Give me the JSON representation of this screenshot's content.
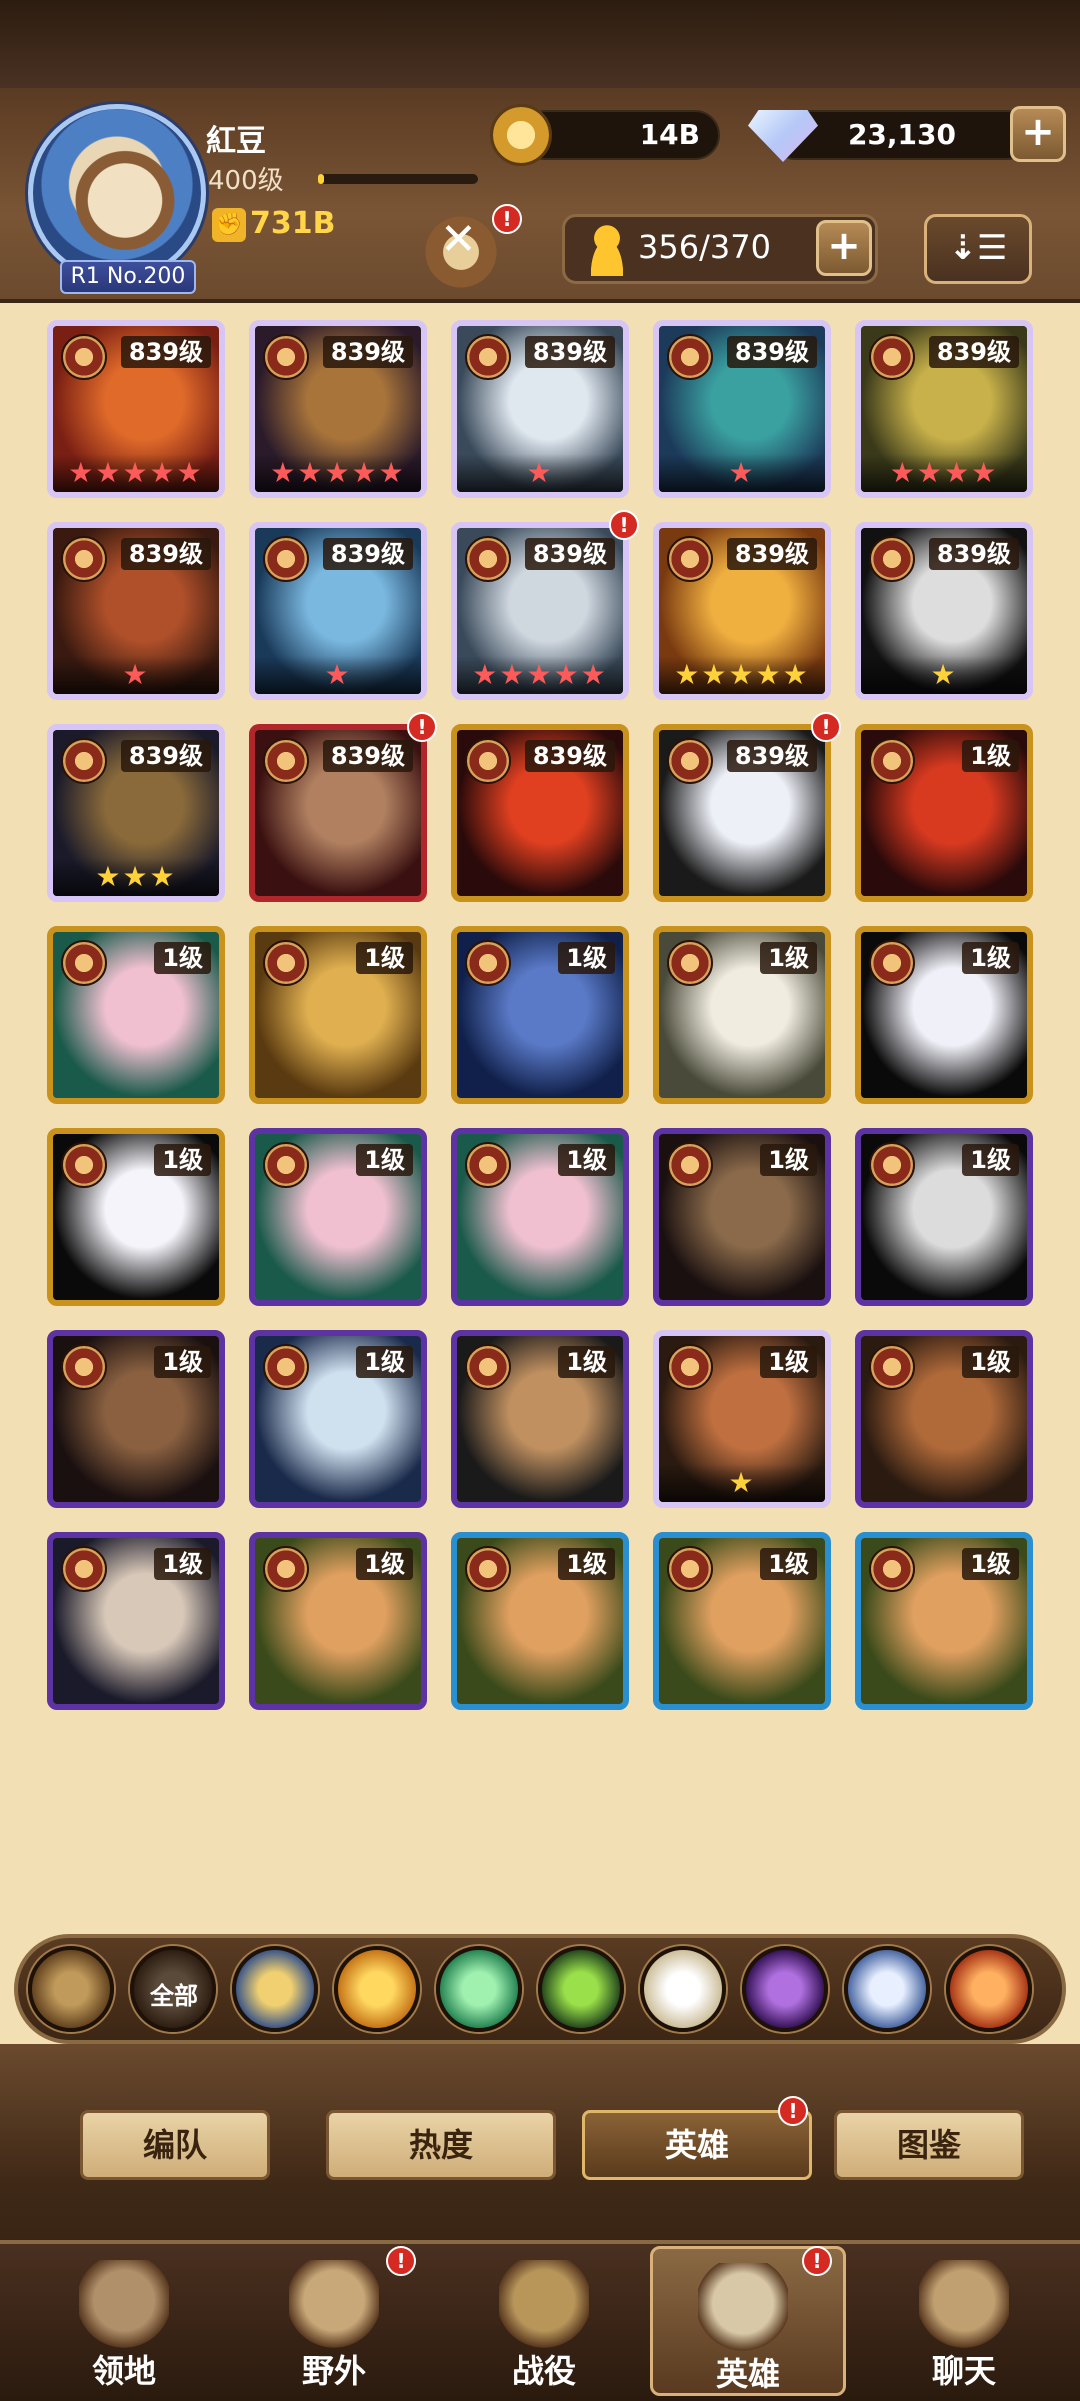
{
  "header": {
    "player_name": "紅豆",
    "player_level": "400级",
    "exp_fraction": 0.04,
    "rank_tag": "R1 No.200",
    "power": "731B",
    "gold": "14B",
    "diamonds": "23,130",
    "hero_slots": "356/370",
    "summon_alert": "!"
  },
  "heroes": [
    {
      "level": "839级",
      "stars": "★★★★★",
      "star_color": "red",
      "tier": "ascended",
      "art": [
        "#7a1f14",
        "#e06a2a"
      ],
      "alert": false
    },
    {
      "level": "839级",
      "stars": "★★★★★",
      "star_color": "red",
      "tier": "ascended",
      "art": [
        "#2a1a2a",
        "#a8743a"
      ],
      "alert": false
    },
    {
      "level": "839级",
      "stars": "★",
      "star_color": "red",
      "tier": "ascended",
      "art": [
        "#3a4a5a",
        "#dfe7ef"
      ],
      "alert": false
    },
    {
      "level": "839级",
      "stars": "★",
      "star_color": "red",
      "tier": "ascended",
      "art": [
        "#1c3a5a",
        "#3aa0a0"
      ],
      "alert": false
    },
    {
      "level": "839级",
      "stars": "★★★★",
      "star_color": "red",
      "tier": "ascended",
      "art": [
        "#3a3a1a",
        "#c8b14a"
      ],
      "alert": false
    },
    {
      "level": "839级",
      "stars": "★",
      "star_color": "red",
      "tier": "ascended",
      "art": [
        "#3a1a10",
        "#b0502a"
      ],
      "alert": false
    },
    {
      "level": "839级",
      "stars": "★",
      "star_color": "red",
      "tier": "ascended",
      "art": [
        "#1a3a5a",
        "#7ab8e0"
      ],
      "alert": false
    },
    {
      "level": "839级",
      "stars": "★★★★★",
      "star_color": "red",
      "tier": "ascended",
      "art": [
        "#3a4a5a",
        "#cfd7df"
      ],
      "alert": true
    },
    {
      "level": "839级",
      "stars": "★★★★★",
      "star_color": "gold",
      "tier": "ascended",
      "art": [
        "#7a3a10",
        "#f0b040"
      ],
      "alert": false
    },
    {
      "level": "839级",
      "stars": "★",
      "star_color": "gold",
      "tier": "ascended",
      "art": [
        "#111111",
        "#dddddd"
      ],
      "alert": false
    },
    {
      "level": "839级",
      "stars": "★★★",
      "star_color": "gold",
      "tier": "ascended",
      "art": [
        "#1a1a2a",
        "#8a6a3a"
      ],
      "alert": false
    },
    {
      "level": "839级",
      "stars": "",
      "star_color": "gold",
      "tier": "red",
      "art": [
        "#3a1010",
        "#b08060"
      ],
      "alert": true
    },
    {
      "level": "839级",
      "stars": "",
      "star_color": "gold",
      "tier": "gold",
      "art": [
        "#2a0a0a",
        "#e04020"
      ],
      "alert": false
    },
    {
      "level": "839级",
      "stars": "",
      "star_color": "gold",
      "tier": "gold",
      "art": [
        "#1a1a1a",
        "#eef0f8"
      ],
      "alert": true
    },
    {
      "level": "1级",
      "stars": "",
      "star_color": "gold",
      "tier": "gold",
      "art": [
        "#2a0a0a",
        "#d83a20"
      ],
      "alert": false
    },
    {
      "level": "1级",
      "stars": "",
      "star_color": "gold",
      "tier": "gold",
      "art": [
        "#1a5a4a",
        "#f0c0d0"
      ],
      "alert": false
    },
    {
      "level": "1级",
      "stars": "",
      "star_color": "gold",
      "tier": "gold",
      "art": [
        "#5a3a10",
        "#e0b050"
      ],
      "alert": false
    },
    {
      "level": "1级",
      "stars": "",
      "star_color": "gold",
      "tier": "gold",
      "art": [
        "#10204a",
        "#5a7ac8"
      ],
      "alert": false
    },
    {
      "level": "1级",
      "stars": "",
      "star_color": "gold",
      "tier": "gold",
      "art": [
        "#4a4a3a",
        "#f0ede0"
      ],
      "alert": false
    },
    {
      "level": "1级",
      "stars": "",
      "star_color": "gold",
      "tier": "gold",
      "art": [
        "#0a0a0a",
        "#f0f0f8"
      ],
      "alert": false
    },
    {
      "level": "1级",
      "stars": "",
      "star_color": "gold",
      "tier": "gold",
      "art": [
        "#0a0a0a",
        "#f4f4fa"
      ],
      "alert": false
    },
    {
      "level": "1级",
      "stars": "",
      "star_color": "gold",
      "tier": "purple",
      "art": [
        "#1a5a4a",
        "#f0c0d0"
      ],
      "alert": false
    },
    {
      "level": "1级",
      "stars": "",
      "star_color": "gold",
      "tier": "purple",
      "art": [
        "#1a5a4a",
        "#f0c0d0"
      ],
      "alert": false
    },
    {
      "level": "1级",
      "stars": "",
      "star_color": "gold",
      "tier": "purple",
      "art": [
        "#1a1010",
        "#8a6a4a"
      ],
      "alert": false
    },
    {
      "level": "1级",
      "stars": "",
      "star_color": "gold",
      "tier": "purple",
      "art": [
        "#0a0a0a",
        "#dcdcdc"
      ],
      "alert": false
    },
    {
      "level": "1级",
      "stars": "",
      "star_color": "gold",
      "tier": "purple",
      "art": [
        "#1a1010",
        "#8a6040"
      ],
      "alert": false
    },
    {
      "level": "1级",
      "stars": "",
      "star_color": "gold",
      "tier": "purple",
      "art": [
        "#1a2a4a",
        "#cfe0ef"
      ],
      "alert": false
    },
    {
      "level": "1级",
      "stars": "",
      "star_color": "gold",
      "tier": "purple",
      "art": [
        "#1a1a1a",
        "#c09060"
      ],
      "alert": false
    },
    {
      "level": "1级",
      "stars": "★",
      "star_color": "gold",
      "tier": "ascended",
      "art": [
        "#2a1a10",
        "#c07040"
      ],
      "alert": false
    },
    {
      "level": "1级",
      "stars": "",
      "star_color": "gold",
      "tier": "purple",
      "art": [
        "#2a1a10",
        "#b06a3a"
      ],
      "alert": false
    },
    {
      "level": "1级",
      "stars": "",
      "star_color": "gold",
      "tier": "purple",
      "art": [
        "#1a1a2a",
        "#d8c8b8"
      ],
      "alert": false
    },
    {
      "level": "1级",
      "stars": "",
      "star_color": "gold",
      "tier": "purple",
      "art": [
        "#3a4a1a",
        "#e0a060"
      ],
      "alert": false
    },
    {
      "level": "1级",
      "stars": "",
      "star_color": "gold",
      "tier": "blue",
      "art": [
        "#3a4a1a",
        "#e0a060"
      ],
      "alert": false
    },
    {
      "level": "1级",
      "stars": "",
      "star_color": "gold",
      "tier": "blue",
      "art": [
        "#3a4a1a",
        "#e0a060"
      ],
      "alert": false
    },
    {
      "level": "1级",
      "stars": "",
      "star_color": "gold",
      "tier": "blue",
      "art": [
        "#3a4a1a",
        "#e0a060"
      ],
      "alert": false
    }
  ],
  "faction_filters": [
    {
      "name": "ascend-filter-icon",
      "label": "",
      "colors": [
        "#c09a5a",
        "#5a3a1a"
      ]
    },
    {
      "name": "all-filter",
      "label": "全部",
      "colors": [
        "#5a4a3a",
        "#2a1a0e"
      ]
    },
    {
      "name": "lightbearer-filter-icon",
      "label": "",
      "colors": [
        "#f0d070",
        "#2a4a8a"
      ]
    },
    {
      "name": "mauler-filter-icon",
      "label": "",
      "colors": [
        "#ffd860",
        "#c06a10"
      ]
    },
    {
      "name": "wilder-filter-icon",
      "label": "",
      "colors": [
        "#a0f0b0",
        "#1a7a4a"
      ]
    },
    {
      "name": "graveborn-filter-icon",
      "label": "",
      "colors": [
        "#9ae04a",
        "#1a3a1a"
      ]
    },
    {
      "name": "celestial-filter-icon",
      "label": "",
      "colors": [
        "#ffffff",
        "#c8b890"
      ]
    },
    {
      "name": "hypogean-filter-icon",
      "label": "",
      "colors": [
        "#b070e0",
        "#2a0a4a"
      ]
    },
    {
      "name": "dimensional-filter-icon",
      "label": "",
      "colors": [
        "#e8f0ff",
        "#3a5a9a"
      ]
    },
    {
      "name": "dragon-filter-icon",
      "label": "",
      "colors": [
        "#ffb060",
        "#a02a10"
      ]
    }
  ],
  "subtabs": [
    {
      "label": "编队",
      "active": false
    },
    {
      "label": "热度",
      "active": false
    },
    {
      "label": "英雄",
      "active": true,
      "alert": "!"
    },
    {
      "label": "图鉴",
      "active": false
    }
  ],
  "nav": [
    {
      "label": "领地",
      "icon": "castle-icon",
      "active": false,
      "alert": false
    },
    {
      "label": "野外",
      "icon": "scroll-map-icon",
      "active": false,
      "alert": true
    },
    {
      "label": "战役",
      "icon": "sword-icon",
      "active": false,
      "alert": false
    },
    {
      "label": "英雄",
      "icon": "helmet-icon",
      "active": true,
      "alert": true
    },
    {
      "label": "聊天",
      "icon": "chat-bubble-icon",
      "active": false,
      "alert": false
    }
  ],
  "alert_mark": "!"
}
